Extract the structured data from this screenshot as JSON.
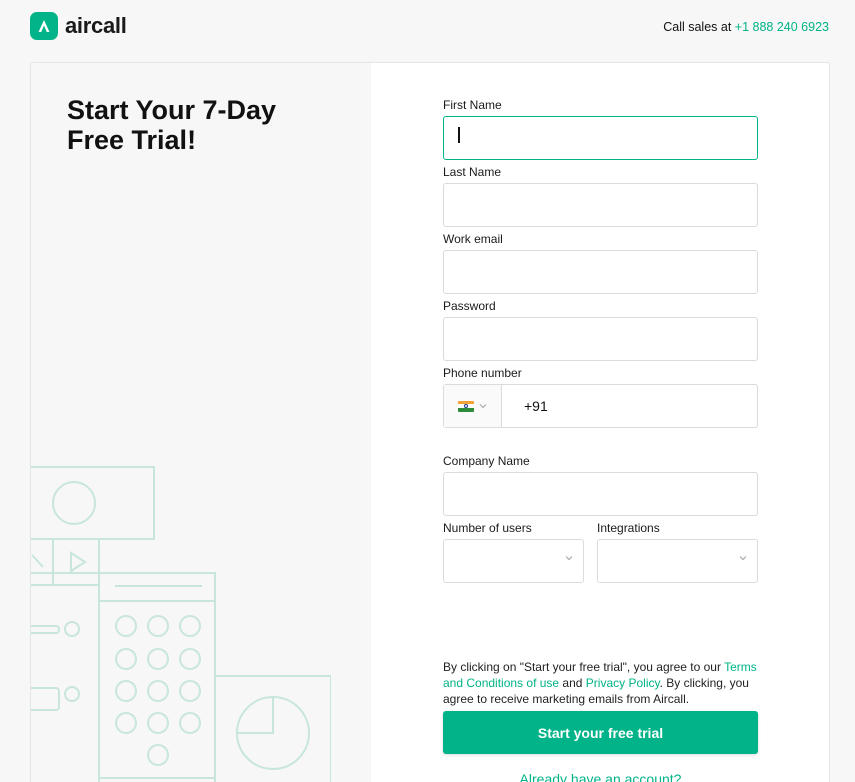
{
  "brand": {
    "name": "aircall",
    "accent": "#00b388"
  },
  "header": {
    "call_sales_prefix": "Call sales at",
    "call_sales_phone": "+1 888 240 6923"
  },
  "hero": {
    "headline": "Start Your 7-Day Free Trial!"
  },
  "form": {
    "first_name": {
      "label": "First Name",
      "value": ""
    },
    "last_name": {
      "label": "Last Name",
      "value": ""
    },
    "work_email": {
      "label": "Work email",
      "value": ""
    },
    "password": {
      "label": "Password",
      "value": ""
    },
    "phone": {
      "label": "Phone number",
      "country_flag": "india-flag-icon",
      "dial_code": "+91"
    },
    "company_name": {
      "label": "Company Name",
      "value": ""
    },
    "number_of_users": {
      "label": "Number of users",
      "value": ""
    },
    "integrations": {
      "label": "Integrations",
      "value": ""
    },
    "legal": {
      "prefix": "By clicking on \"Start your free trial\", you agree to our ",
      "terms_link": "Terms and Conditions of use",
      "and": " and ",
      "privacy_link": "Privacy Policy",
      "suffix": ". By clicking, you agree to receive marketing emails from Aircall."
    },
    "submit_label": "Start your free trial",
    "login_link": "Already have an account?"
  }
}
